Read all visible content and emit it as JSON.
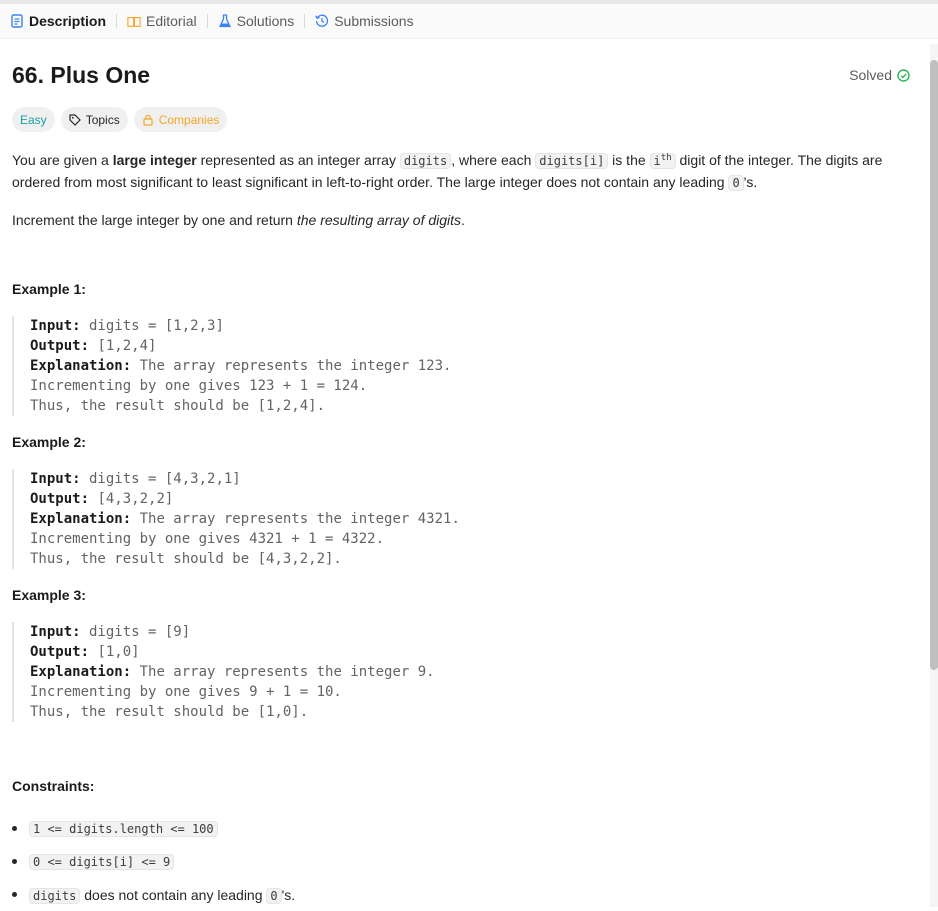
{
  "tabs": [
    {
      "label": "Description",
      "icon": "description-icon",
      "active": true
    },
    {
      "label": "Editorial",
      "icon": "book-icon"
    },
    {
      "label": "Solutions",
      "icon": "flask-icon"
    },
    {
      "label": "Submissions",
      "icon": "history-icon"
    }
  ],
  "problem": {
    "title": "66. Plus One",
    "solved_label": "Solved",
    "difficulty": "Easy",
    "topics_label": "Topics",
    "companies_label": "Companies"
  },
  "description": {
    "p1_a": "You are given a ",
    "p1_bold": "large integer",
    "p1_b": " represented as an integer array ",
    "p1_code1": "digits",
    "p1_c": ", where each ",
    "p1_code2": "digits[i]",
    "p1_d": " is the ",
    "p1_code3": "i",
    "p1_sup": "th",
    "p1_e": " digit of the integer. The digits are ordered from most significant to least significant in left-to-right order. The large integer does not contain any leading ",
    "p1_code4": "0",
    "p1_f": "'s.",
    "p2_a": "Increment the large integer by one and return ",
    "p2_em": "the resulting array of digits",
    "p2_b": "."
  },
  "examples": [
    {
      "title": "Example 1:",
      "input_label": "Input:",
      "input": " digits = [1,2,3]",
      "output_label": "Output:",
      "output": " [1,2,4]",
      "explanation_label": "Explanation:",
      "explanation": " The array represents the integer 123.",
      "line2": "Incrementing by one gives 123 + 1 = 124.",
      "line3": "Thus, the result should be [1,2,4]."
    },
    {
      "title": "Example 2:",
      "input_label": "Input:",
      "input": " digits = [4,3,2,1]",
      "output_label": "Output:",
      "output": " [4,3,2,2]",
      "explanation_label": "Explanation:",
      "explanation": " The array represents the integer 4321.",
      "line2": "Incrementing by one gives 4321 + 1 = 4322.",
      "line3": "Thus, the result should be [4,3,2,2]."
    },
    {
      "title": "Example 3:",
      "input_label": "Input:",
      "input": " digits = [9]",
      "output_label": "Output:",
      "output": " [1,0]",
      "explanation_label": "Explanation:",
      "explanation": " The array represents the integer 9.",
      "line2": "Incrementing by one gives 9 + 1 = 10.",
      "line3": "Thus, the result should be [1,0]."
    }
  ],
  "constraints": {
    "title": "Constraints:",
    "c1": "1 <= digits.length <= 100",
    "c2": "0 <= digits[i] <= 9",
    "c3_code": "digits",
    "c3_text": " does not contain any leading ",
    "c3_code2": "0",
    "c3_end": "'s."
  },
  "colors": {
    "easy": "#1a9ea0",
    "companies": "#f5a623",
    "solved_check": "#2db55d",
    "tab_icon_blue": "#3b82f6"
  }
}
